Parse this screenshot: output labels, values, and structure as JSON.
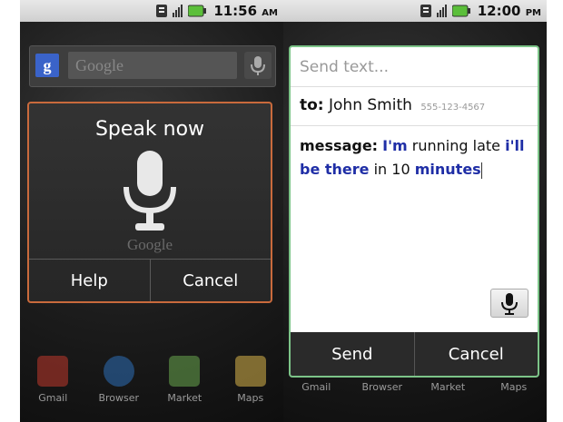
{
  "left_phone": {
    "time": "11:56",
    "ampm": "AM",
    "search_placeholder": "Google",
    "google_letter": "g",
    "dialog": {
      "title": "Speak now",
      "watermark": "Google",
      "help_label": "Help",
      "cancel_label": "Cancel"
    },
    "dock": [
      {
        "label": "Gmail",
        "color": "#c0392b"
      },
      {
        "label": "Browser",
        "color": "#2e6fb8"
      },
      {
        "label": "Market",
        "color": "#6aa84f"
      },
      {
        "label": "Maps",
        "color": "#d9b44a"
      }
    ]
  },
  "right_phone": {
    "time": "12:00",
    "ampm": "PM",
    "sms": {
      "header_placeholder": "Send text...",
      "to_label": "to:",
      "to_name": "John Smith",
      "to_number": "555-123-4567",
      "message_label": "message:",
      "msg_parts": [
        "I'm",
        "running late",
        "i'll be there",
        "in 10",
        "minutes"
      ],
      "send_label": "Send",
      "cancel_label": "Cancel"
    },
    "dock": [
      {
        "label": "Gmail"
      },
      {
        "label": "Browser"
      },
      {
        "label": "Market"
      },
      {
        "label": "Maps"
      }
    ]
  },
  "colors": {
    "dialog_border_left": "#c96a3c",
    "dialog_border_right": "#7cc488",
    "highlight_text": "#1f2ea6"
  }
}
